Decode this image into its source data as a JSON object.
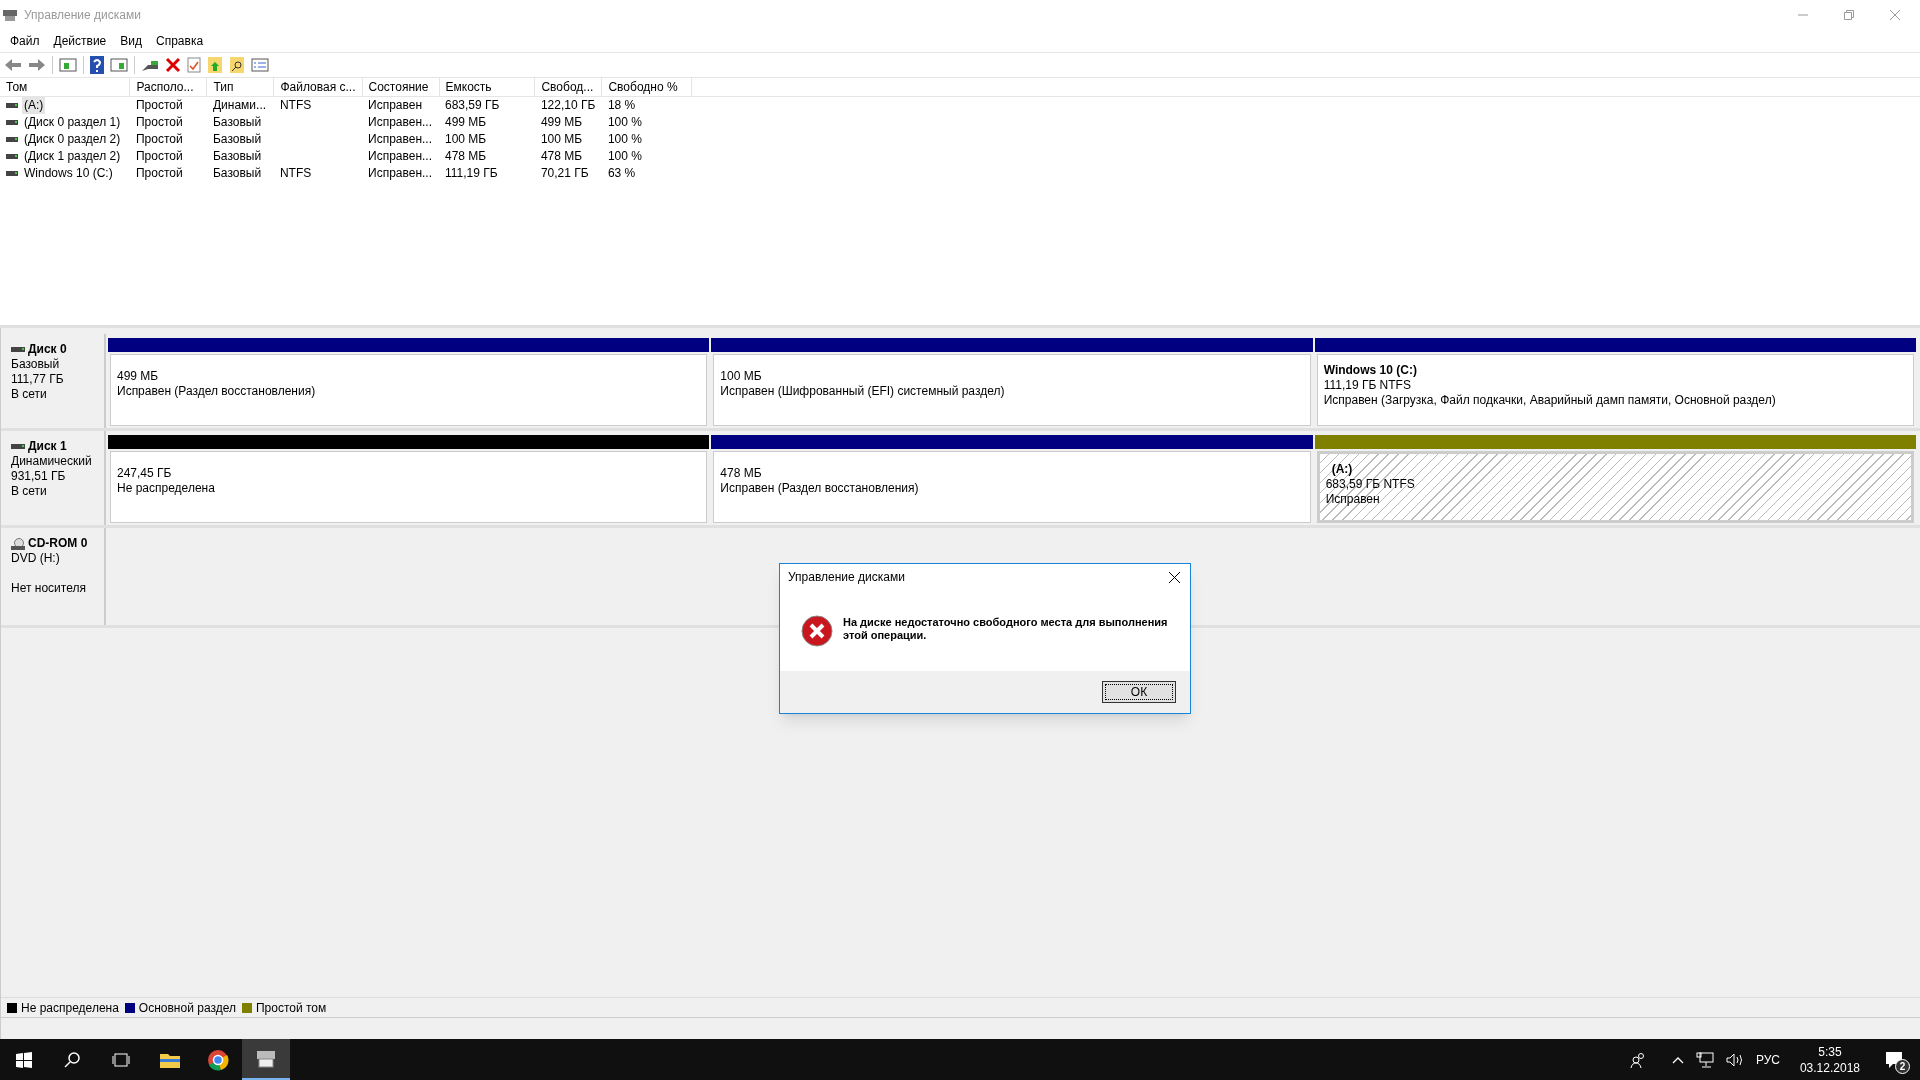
{
  "window": {
    "title": "Управление дисками"
  },
  "menu": [
    "Файл",
    "Действие",
    "Вид",
    "Справка"
  ],
  "table": {
    "columns": [
      "Том",
      "Располо...",
      "Тип",
      "Файловая с...",
      "Состояние",
      "Емкость",
      "Свобод...",
      "Свободно %"
    ],
    "rows": [
      {
        "selected": true,
        "cells": [
          "(A:)",
          "Простой",
          "Динами...",
          "NTFS",
          "Исправен",
          "683,59 ГБ",
          "122,10 ГБ",
          "18 %"
        ]
      },
      {
        "selected": false,
        "cells": [
          "(Диск 0 раздел 1)",
          "Простой",
          "Базовый",
          "",
          "Исправен...",
          "499 МБ",
          "499 МБ",
          "100 %"
        ]
      },
      {
        "selected": false,
        "cells": [
          "(Диск 0 раздел 2)",
          "Простой",
          "Базовый",
          "",
          "Исправен...",
          "100 МБ",
          "100 МБ",
          "100 %"
        ]
      },
      {
        "selected": false,
        "cells": [
          "(Диск 1 раздел 2)",
          "Простой",
          "Базовый",
          "",
          "Исправен...",
          "478 МБ",
          "478 МБ",
          "100 %"
        ]
      },
      {
        "selected": false,
        "cells": [
          "Windows 10 (C:)",
          "Простой",
          "Базовый",
          "NTFS",
          "Исправен...",
          "111,19 ГБ",
          "70,21 ГБ",
          "63 %"
        ]
      }
    ]
  },
  "disks": [
    {
      "kind": "disk",
      "name": "Диск 0",
      "lines": [
        "Базовый",
        "111,77 ГБ",
        "В сети"
      ],
      "partitions": [
        {
          "color": "#000080",
          "selected": false,
          "lines": [
            "499 МБ",
            "Исправен (Раздел восстановления)"
          ]
        },
        {
          "color": "#000080",
          "selected": false,
          "lines": [
            "100 МБ",
            "Исправен (Шифрованный (EFI) системный раздел)"
          ]
        },
        {
          "color": "#000080",
          "selected": false,
          "title": "Windows 10  (C:)",
          "lines": [
            "111,19 ГБ NTFS",
            "Исправен (Загрузка, Файл подкачки, Аварийный дамп памяти, Основной раздел)"
          ]
        }
      ]
    },
    {
      "kind": "disk",
      "name": "Диск 1",
      "lines": [
        "Динамический",
        "931,51 ГБ",
        "В сети"
      ],
      "partitions": [
        {
          "color": "#000000",
          "selected": false,
          "lines": [
            "247,45 ГБ",
            "Не распределена"
          ]
        },
        {
          "color": "#000080",
          "selected": false,
          "lines": [
            "478 МБ",
            "Исправен (Раздел восстановления)"
          ]
        },
        {
          "color": "#808000",
          "selected": true,
          "title": "(A:)",
          "lines": [
            "683,59 ГБ NTFS",
            "Исправен"
          ]
        }
      ]
    },
    {
      "kind": "cdrom",
      "name": "CD-ROM 0",
      "lines": [
        "DVD (H:)"
      ],
      "media": "Нет носителя"
    }
  ],
  "legend": [
    {
      "color": "#000000",
      "label": "Не распределена"
    },
    {
      "color": "#000080",
      "label": "Основной раздел"
    },
    {
      "color": "#808000",
      "label": "Простой том"
    }
  ],
  "dialog": {
    "title": "Управление дисками",
    "message": "На диске недостаточно свободного места для выполнения этой операции.",
    "button": "ОК"
  },
  "taskbar": {
    "apps": [
      {
        "kind": "explorer",
        "selected": false
      },
      {
        "kind": "chrome",
        "selected": false
      },
      {
        "kind": "diskmgmt",
        "selected": true
      }
    ],
    "language": "РУС",
    "time": "5:35",
    "date": "03.12.2018",
    "notifications": "2"
  }
}
